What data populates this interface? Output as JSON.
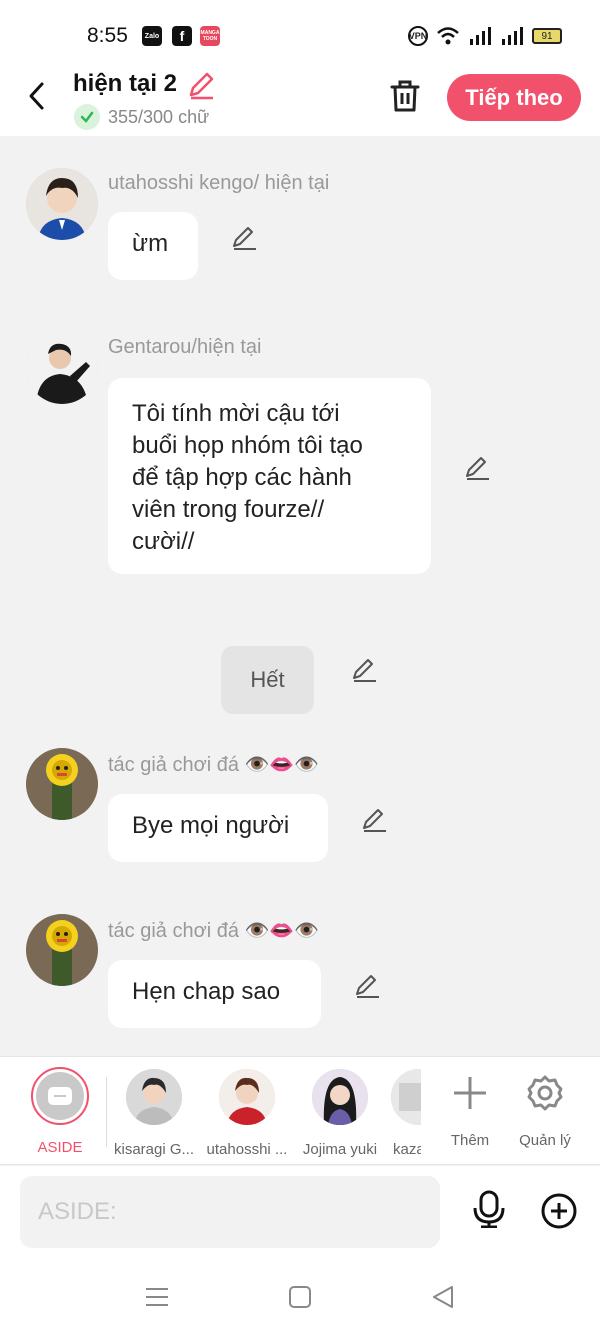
{
  "status_bar": {
    "time": "8:55",
    "battery": "91",
    "vpn": "VPN",
    "apps": [
      "Zalo",
      "f",
      "MANGA TOON"
    ]
  },
  "header": {
    "title": "hiện tại 2",
    "word_count": "355/300 chữ",
    "next_button": "Tiếp theo"
  },
  "messages": [
    {
      "sender": "utahosshi kengo/ hiện tại",
      "text": "ừm"
    },
    {
      "sender": "Gentarou/hiện tại",
      "lines": [
        "Tôi tính mời cậu tới",
        "buổi họp nhóm tôi tạo",
        "để tập hợp các hành",
        "viên trong fourze//",
        "cười//"
      ]
    },
    {
      "end_label": "Hết"
    },
    {
      "sender": "tác giả chơi đá 👁️👄👁️",
      "text": "Bye mọi người"
    },
    {
      "sender": "tác giả chơi đá 👁️👄👁️",
      "text": "Hẹn chap sao"
    }
  ],
  "characters": [
    {
      "label": "ASIDE",
      "active": true
    },
    {
      "label": "kisaragi G..."
    },
    {
      "label": "utahosshi ..."
    },
    {
      "label": "Jojima yuki"
    },
    {
      "label": "kaza"
    }
  ],
  "actions": {
    "add": "Thêm",
    "manage": "Quản lý"
  },
  "input": {
    "placeholder": "ASIDE:"
  },
  "colors": {
    "accent": "#f2516b",
    "background": "#f2f2f2"
  }
}
